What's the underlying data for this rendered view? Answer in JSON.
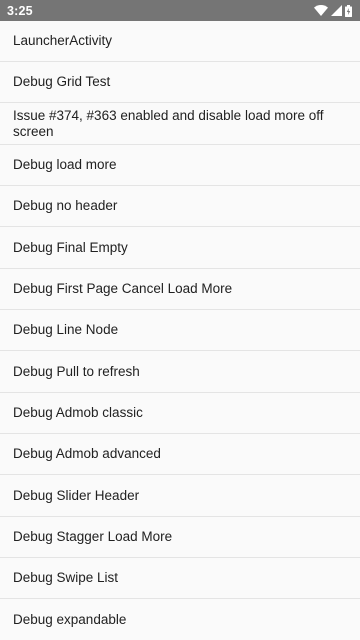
{
  "status_bar": {
    "time": "3:25",
    "icons": [
      "wifi-icon",
      "cellular-signal-icon",
      "battery-charging-icon"
    ],
    "background": "#757575"
  },
  "list": {
    "items": [
      {
        "label": "LauncherActivity"
      },
      {
        "label": "Debug Grid Test"
      },
      {
        "label": "Issue #374, #363 enabled and disable load more off screen"
      },
      {
        "label": "Debug load more"
      },
      {
        "label": "Debug no header"
      },
      {
        "label": "Debug Final Empty"
      },
      {
        "label": "Debug First Page Cancel Load More"
      },
      {
        "label": "Debug Line Node"
      },
      {
        "label": "Debug Pull to refresh"
      },
      {
        "label": "Debug Admob classic"
      },
      {
        "label": "Debug Admob advanced"
      },
      {
        "label": "Debug Slider Header"
      },
      {
        "label": "Debug Stagger Load More"
      },
      {
        "label": "Debug Swipe List"
      },
      {
        "label": "Debug expandable"
      }
    ]
  }
}
